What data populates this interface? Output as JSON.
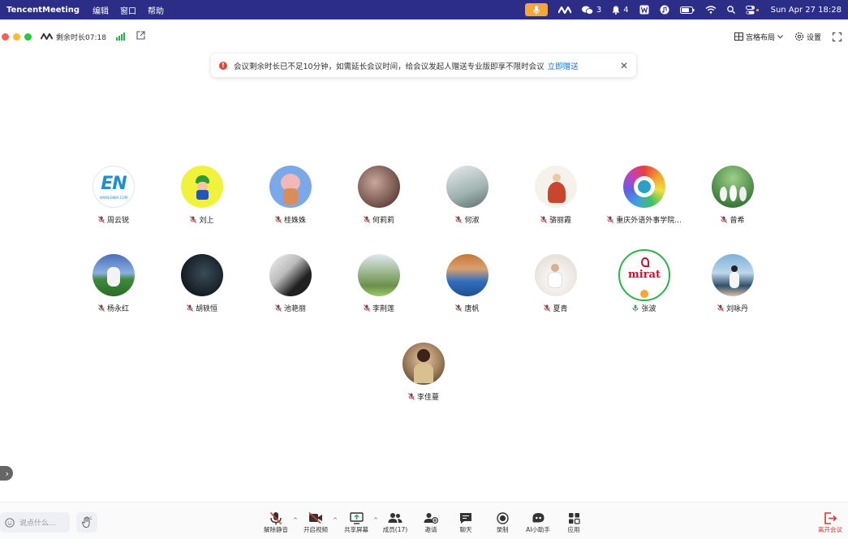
{
  "menubar": {
    "app": "TencentMeeting",
    "menus": [
      "编辑",
      "窗口",
      "帮助"
    ],
    "wechat_count": "3",
    "bell_count": "4",
    "datetime": "Sun Apr 27  18:28"
  },
  "titlebar": {
    "remaining_time": "剩余时长07:18",
    "layout_label": "宫格布局",
    "settings_label": "设置"
  },
  "notice": {
    "message": "会议剩余时长已不足10分钟，如需延长会议时间，给会议发起人赠送专业版即享不限时会议",
    "link": "立即赠送"
  },
  "participants": [
    {
      "name": "周云锐",
      "muted": true
    },
    {
      "name": "刘上",
      "muted": true
    },
    {
      "name": "桂姝姝",
      "muted": true
    },
    {
      "name": "何莉莉",
      "muted": true
    },
    {
      "name": "何淑",
      "muted": true
    },
    {
      "name": "骆丽霞",
      "muted": true
    },
    {
      "name": "重庆外语外事学院...",
      "muted": true
    },
    {
      "name": "曾希",
      "muted": true
    },
    {
      "name": "杨永红",
      "muted": true
    },
    {
      "name": "胡轶恒",
      "muted": true
    },
    {
      "name": "池艳丽",
      "muted": true
    },
    {
      "name": "李荆莲",
      "muted": true
    },
    {
      "name": "唐帆",
      "muted": true
    },
    {
      "name": "夏青",
      "muted": true
    },
    {
      "name": "张波",
      "muted": false
    },
    {
      "name": "刘咏丹",
      "muted": true
    },
    {
      "name": "李佳蔓",
      "muted": true
    }
  ],
  "avatar_text": {
    "en_logo": "EN",
    "en_url": "WWW.ENBA.COM",
    "mira": "mirat"
  },
  "bottombar": {
    "chat_placeholder": "说点什么...",
    "tools": {
      "unmute": "解除静音",
      "start_video": "开启视频",
      "share_screen": "共享屏幕",
      "members": "成员(17)",
      "invite": "邀请",
      "chat": "聊天",
      "record": "录制",
      "ai_assistant": "AI小助手",
      "apps": "应用",
      "leave": "离开会议"
    }
  },
  "colors": {
    "menubar": "#2c2d86",
    "mic_pill": "#f4a63a",
    "link": "#1a73e8",
    "warning": "#d84a3a",
    "leave": "#dd3333",
    "speaking_ring": "#2bb24c"
  }
}
